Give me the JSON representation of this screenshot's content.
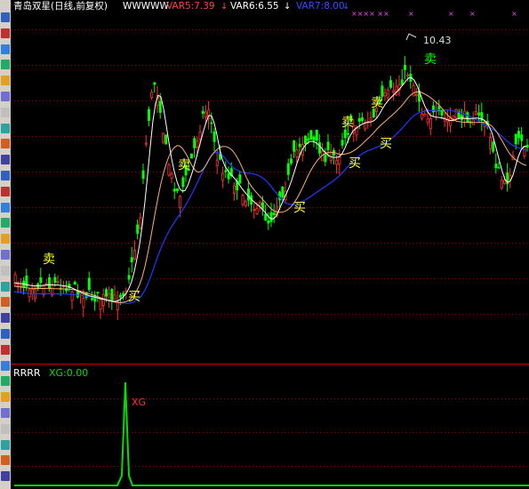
{
  "header": {
    "title": "青岛双星(日线,前复权)",
    "indicator_name": "WWWWW",
    "var5": "VAR5:7.39",
    "var6": "VAR6:6.55",
    "var7": "VAR7:8.00"
  },
  "sub_panel": {
    "title": "RRRR",
    "value": "XG:0.00",
    "signal_label": "XG"
  },
  "price_high_label": "10.43",
  "buy_label": "买",
  "sell_label": "卖",
  "colors": {
    "up": "#ff3232",
    "down": "#00ff00",
    "ma_white": "#ffffff",
    "ma_orange": "#ffb070",
    "ma_blue": "#1a3cff",
    "grid": "#a00000",
    "signal_text": "#ffff40",
    "header_var5": "#ff4040",
    "header_var6": "#ffffff",
    "header_var7": "#3050ff",
    "xg_green": "#00e000"
  },
  "toolbar_icons": [
    "window-icon",
    "close-icon",
    "new-window-icon",
    "chart-icon",
    "grid-icon",
    "list-icon",
    "report-icon",
    "news-icon",
    "warning-icon",
    "person-icon",
    "info-icon",
    "globe-icon",
    "calendar-icon",
    "document-icon",
    "finance-icon",
    "zoom-icon",
    "print-icon",
    "stats-icon",
    "table-icon",
    "select-icon",
    "export-icon",
    "image-icon",
    "layout-icon",
    "tools-icon",
    "cursor-icon",
    "magnify-icon",
    "pen-icon",
    "move-icon",
    "up-arrow-icon",
    "down-arrow-icon"
  ],
  "chart_data": {
    "type": "candlestick",
    "price_high": 10.43,
    "xg_value": 0.0,
    "price_panel_gridlines": 9,
    "sub_panel_gridlines": 3,
    "buy_signals": 4,
    "sell_signals": 5
  }
}
